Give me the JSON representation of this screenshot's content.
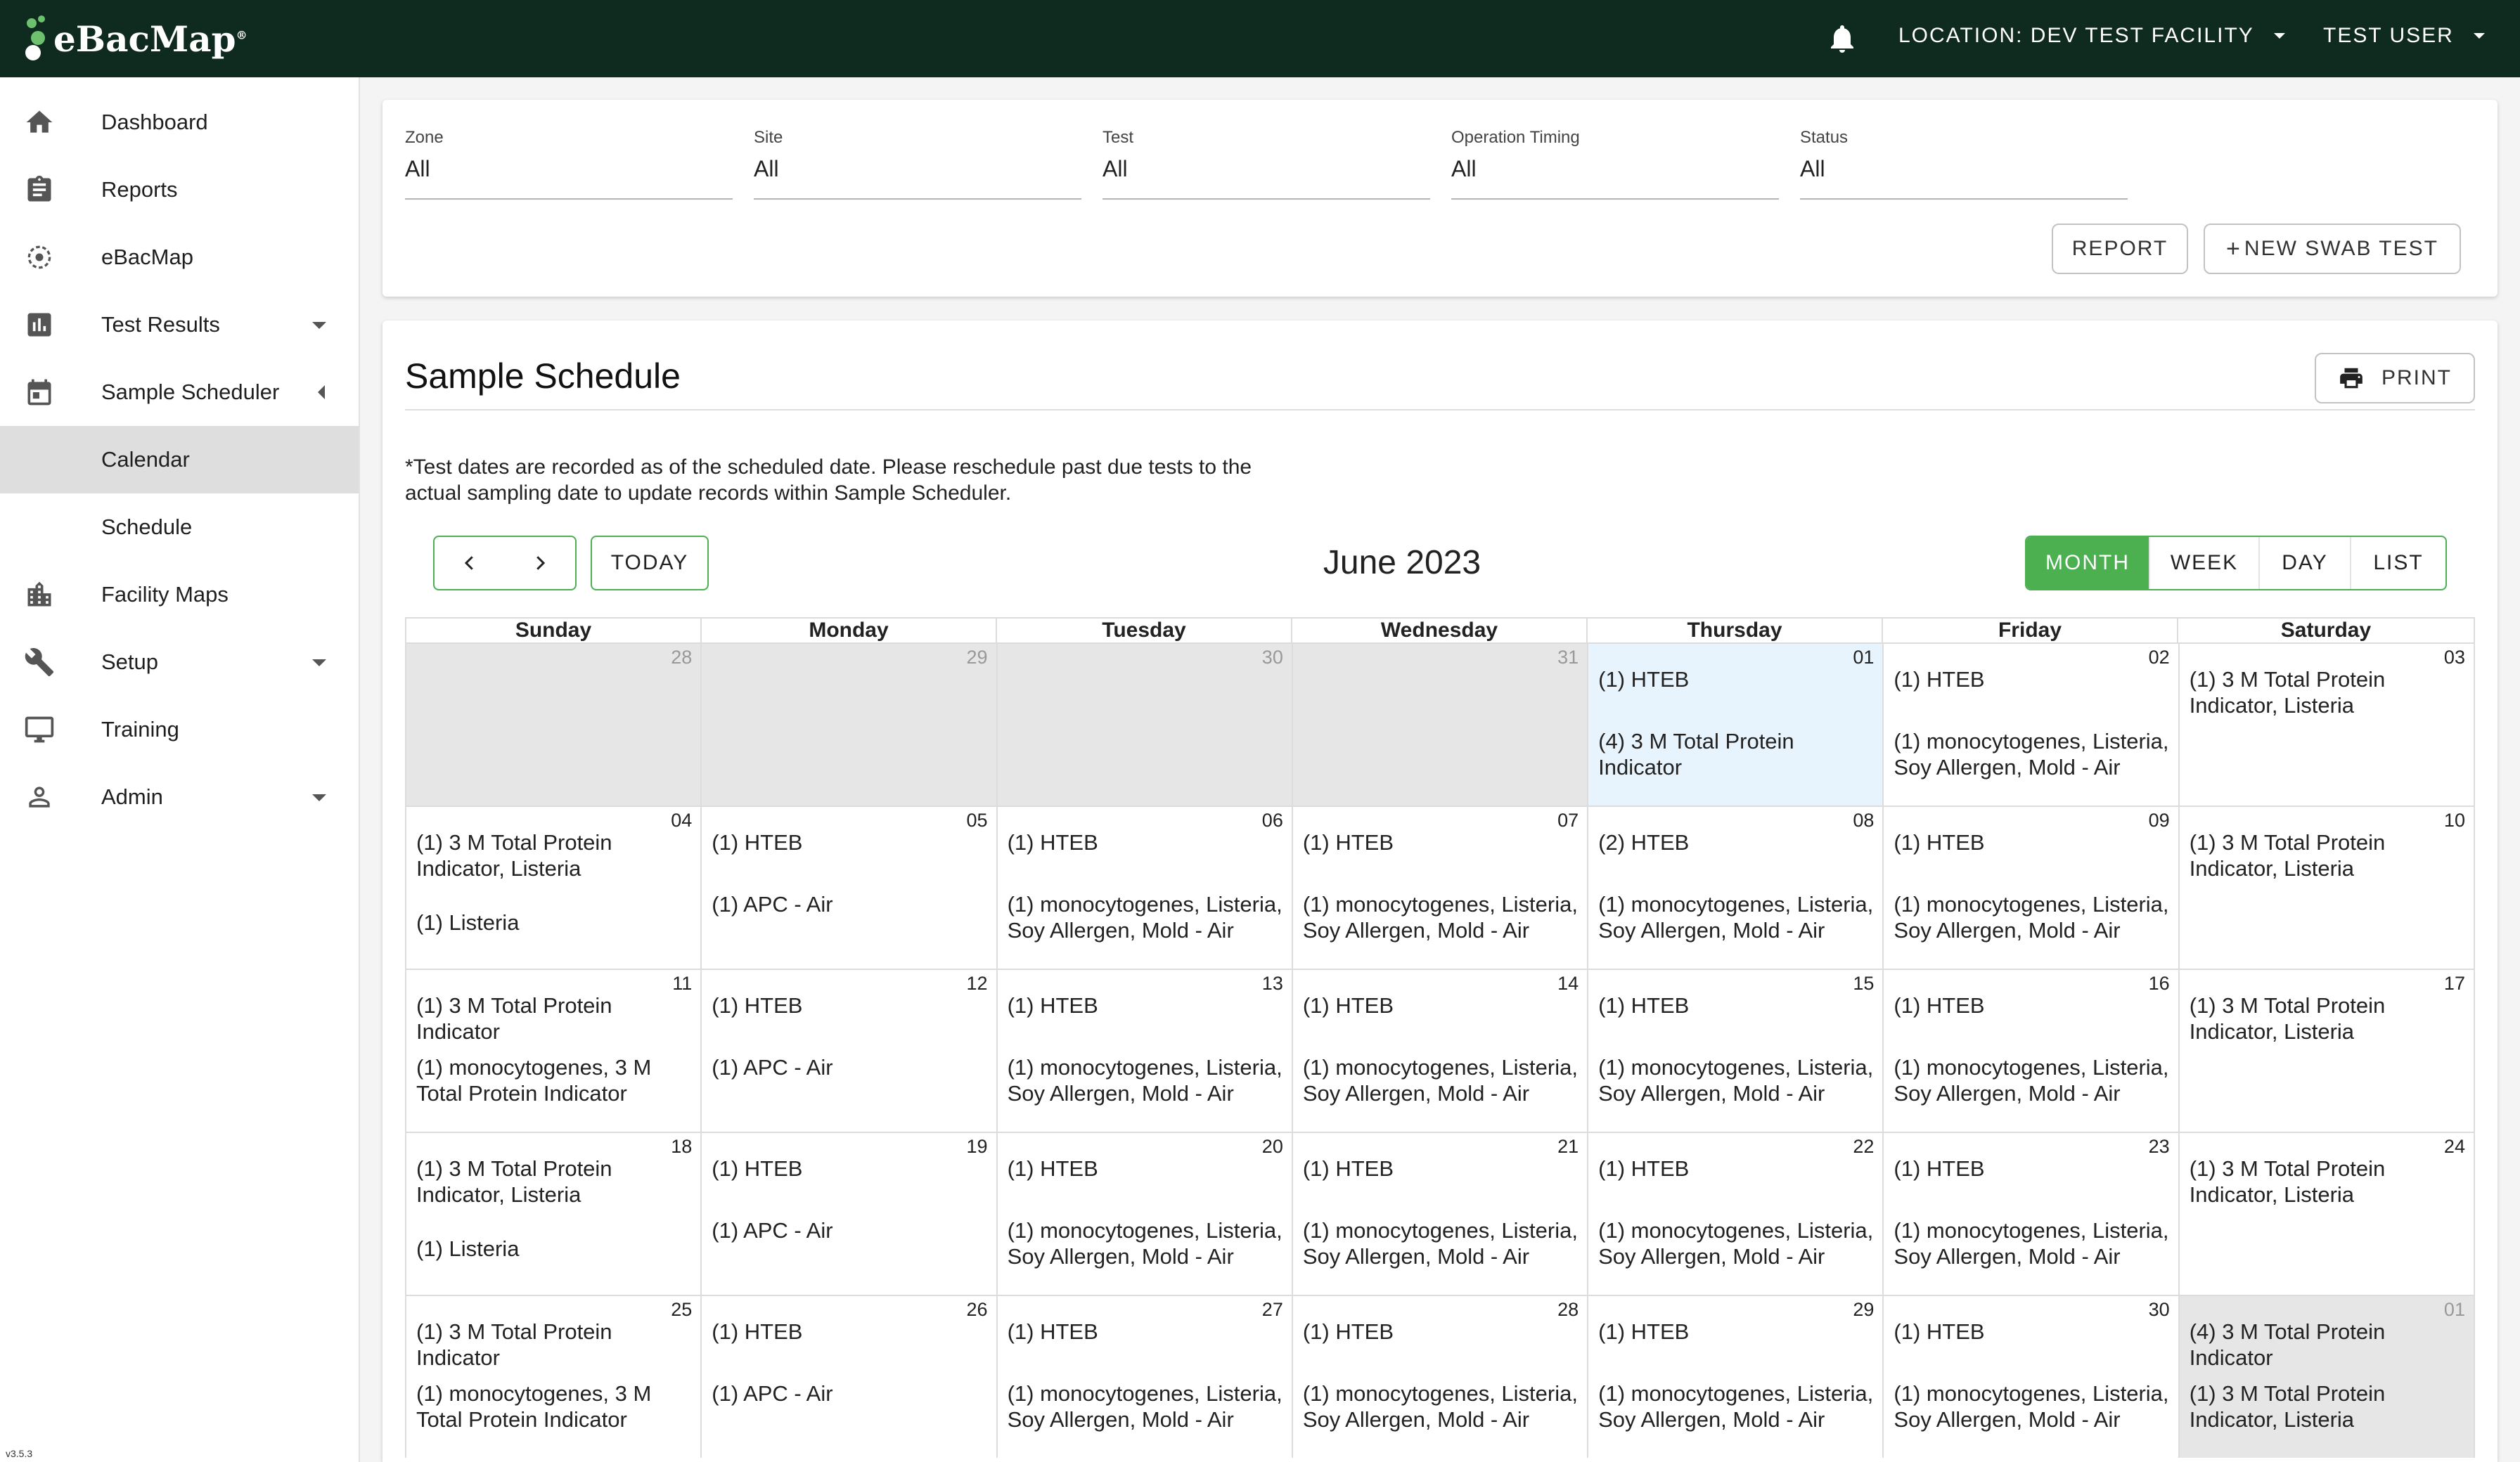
{
  "app": {
    "logo_text": "eBacMap",
    "logo_mark": "®",
    "location_label": "LOCATION: DEV TEST FACILITY",
    "user_label": "TEST USER",
    "version": "v3.5.3"
  },
  "sidebar": {
    "items": [
      {
        "label": "Dashboard",
        "icon": "home-icon"
      },
      {
        "label": "Reports",
        "icon": "clipboard-icon"
      },
      {
        "label": "eBacMap",
        "icon": "target-icon"
      },
      {
        "label": "Test Results",
        "icon": "bar-chart-icon"
      },
      {
        "label": "Sample Scheduler",
        "icon": "calendar-icon"
      },
      {
        "label": "Calendar"
      },
      {
        "label": "Schedule"
      },
      {
        "label": "Facility Maps",
        "icon": "building-icon"
      },
      {
        "label": "Setup",
        "icon": "wrench-icon"
      },
      {
        "label": "Training",
        "icon": "monitor-icon"
      },
      {
        "label": "Admin",
        "icon": "person-icon"
      }
    ]
  },
  "filters": [
    {
      "label": "Zone",
      "value": "All"
    },
    {
      "label": "Site",
      "value": "All"
    },
    {
      "label": "Test",
      "value": "All"
    },
    {
      "label": "Operation Timing",
      "value": "All"
    },
    {
      "label": "Status",
      "value": "All"
    }
  ],
  "actions": {
    "report_label": "REPORT",
    "new_swab_label": "NEW SWAB TEST"
  },
  "schedule": {
    "title": "Sample Schedule",
    "print_label": "PRINT",
    "note": "*Test dates are recorded as of the scheduled date. Please reschedule past due tests to the actual sampling date to update records within Sample Scheduler.",
    "today_label": "TODAY",
    "month_title": "June 2023",
    "views": [
      "MONTH",
      "WEEK",
      "DAY",
      "LIST"
    ],
    "active_view": "MONTH",
    "weekdays": [
      "Sunday",
      "Monday",
      "Tuesday",
      "Wednesday",
      "Thursday",
      "Friday",
      "Saturday"
    ]
  },
  "calendar": {
    "weeks": [
      [
        {
          "num": "28",
          "other": true,
          "e1": "",
          "e2": ""
        },
        {
          "num": "29",
          "other": true,
          "e1": "",
          "e2": ""
        },
        {
          "num": "30",
          "other": true,
          "e1": "",
          "e2": ""
        },
        {
          "num": "31",
          "other": true,
          "e1": "",
          "e2": ""
        },
        {
          "num": "01",
          "today": true,
          "e1": "(1) HTEB",
          "e2": "(4) 3 M Total Protein Indicator"
        },
        {
          "num": "02",
          "e1": "(1) HTEB",
          "e2": "(1) monocytogenes, Listeria, Soy Allergen, Mold - Air"
        },
        {
          "num": "03",
          "e1": "(1) 3 M Total Protein Indicator, Listeria",
          "e2": ""
        }
      ],
      [
        {
          "num": "04",
          "e1": "(1) 3 M Total Protein Indicator, Listeria",
          "e2": "(1) Listeria",
          "e2top": 146
        },
        {
          "num": "05",
          "e1": "(1) HTEB",
          "e2": "(1) APC - Air"
        },
        {
          "num": "06",
          "e1": "(1) HTEB",
          "e2": "(1) monocytogenes, Listeria, Soy Allergen, Mold - Air"
        },
        {
          "num": "07",
          "e1": "(1) HTEB",
          "e2": "(1) monocytogenes, Listeria, Soy Allergen, Mold - Air"
        },
        {
          "num": "08",
          "e1": "(2) HTEB",
          "e2": "(1) monocytogenes, Listeria, Soy Allergen, Mold - Air"
        },
        {
          "num": "09",
          "e1": "(1) HTEB",
          "e2": "(1) monocytogenes, Listeria, Soy Allergen, Mold - Air"
        },
        {
          "num": "10",
          "e1": "(1) 3 M Total Protein Indicator, Listeria",
          "e2": ""
        }
      ],
      [
        {
          "num": "11",
          "e1": "(1) 3 M Total Protein Indicator",
          "e2": "(1) monocytogenes, 3 M Total Protein Indicator"
        },
        {
          "num": "12",
          "e1": "(1) HTEB",
          "e2": "(1) APC - Air"
        },
        {
          "num": "13",
          "e1": "(1) HTEB",
          "e2": "(1) monocytogenes, Listeria, Soy Allergen, Mold - Air"
        },
        {
          "num": "14",
          "e1": "(1) HTEB",
          "e2": "(1) monocytogenes, Listeria, Soy Allergen, Mold - Air"
        },
        {
          "num": "15",
          "e1": "(1) HTEB",
          "e2": "(1) monocytogenes, Listeria, Soy Allergen, Mold - Air"
        },
        {
          "num": "16",
          "e1": "(1) HTEB",
          "e2": "(1) monocytogenes, Listeria, Soy Allergen, Mold - Air"
        },
        {
          "num": "17",
          "e1": "(1) 3 M Total Protein Indicator, Listeria",
          "e2": ""
        }
      ],
      [
        {
          "num": "18",
          "e1": "(1) 3 M Total Protein Indicator, Listeria",
          "e2": "(1) Listeria",
          "e2top": 146
        },
        {
          "num": "19",
          "e1": "(1) HTEB",
          "e2": "(1) APC - Air"
        },
        {
          "num": "20",
          "e1": "(1) HTEB",
          "e2": "(1) monocytogenes, Listeria, Soy Allergen, Mold - Air"
        },
        {
          "num": "21",
          "e1": "(1) HTEB",
          "e2": "(1) monocytogenes, Listeria, Soy Allergen, Mold - Air"
        },
        {
          "num": "22",
          "e1": "(1) HTEB",
          "e2": "(1) monocytogenes, Listeria, Soy Allergen, Mold - Air"
        },
        {
          "num": "23",
          "e1": "(1) HTEB",
          "e2": "(1) monocytogenes, Listeria, Soy Allergen, Mold - Air"
        },
        {
          "num": "24",
          "e1": "(1) 3 M Total Protein Indicator, Listeria",
          "e2": ""
        }
      ],
      [
        {
          "num": "25",
          "e1": "(1) 3 M Total Protein Indicator",
          "e2": "(1) monocytogenes, 3 M Total Protein Indicator"
        },
        {
          "num": "26",
          "e1": "(1) HTEB",
          "e2": "(1) APC - Air"
        },
        {
          "num": "27",
          "e1": "(1) HTEB",
          "e2": "(1) monocytogenes, Listeria, Soy Allergen, Mold - Air"
        },
        {
          "num": "28",
          "e1": "(1) HTEB",
          "e2": "(1) monocytogenes, Listeria, Soy Allergen, Mold - Air"
        },
        {
          "num": "29",
          "e1": "(1) HTEB",
          "e2": "(1) monocytogenes, Listeria, Soy Allergen, Mold - Air"
        },
        {
          "num": "30",
          "e1": "(1) HTEB",
          "e2": "(1) monocytogenes, Listeria, Soy Allergen, Mold - Air"
        },
        {
          "num": "01",
          "other": true,
          "e1": "(4) 3 M Total Protein Indicator",
          "e2": "(1) 3 M Total Protein Indicator, Listeria"
        }
      ]
    ]
  },
  "colors": {
    "header_bg": "#0f2a1e",
    "accent_green": "#4caf50",
    "today_bg": "#e8f4fd",
    "other_month_bg": "#e6e6e6",
    "active_nav_bg": "#dedede"
  }
}
